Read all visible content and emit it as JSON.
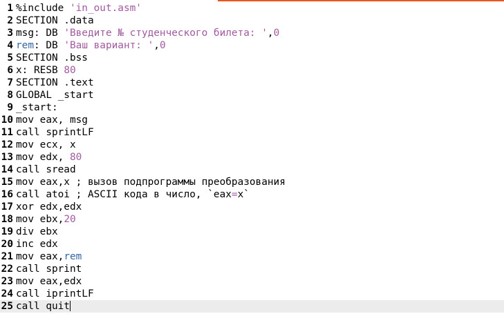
{
  "colors": {
    "accent": "#e95420",
    "string": "#a25aa0",
    "number": "#a25aa0",
    "identifier": "#3465a4",
    "current_line": "#ececec"
  },
  "editor": {
    "current_line": 25,
    "lines": [
      {
        "n": "1",
        "tokens": [
          {
            "t": "%include ",
            "c": "plain"
          },
          {
            "t": "'in_out.asm'",
            "c": "str"
          }
        ]
      },
      {
        "n": "2",
        "tokens": [
          {
            "t": "SECTION .data",
            "c": "plain"
          }
        ]
      },
      {
        "n": "3",
        "tokens": [
          {
            "t": "msg: DB ",
            "c": "plain"
          },
          {
            "t": "'Введите № студенческого билета: '",
            "c": "str"
          },
          {
            "t": ",",
            "c": "plain"
          },
          {
            "t": "0",
            "c": "num"
          }
        ]
      },
      {
        "n": "4",
        "tokens": [
          {
            "t": "rem",
            "c": "id"
          },
          {
            "t": ": DB ",
            "c": "plain"
          },
          {
            "t": "'Ваш вариант: '",
            "c": "str"
          },
          {
            "t": ",",
            "c": "plain"
          },
          {
            "t": "0",
            "c": "num"
          }
        ]
      },
      {
        "n": "5",
        "tokens": [
          {
            "t": "SECTION .bss",
            "c": "plain"
          }
        ]
      },
      {
        "n": "6",
        "tokens": [
          {
            "t": "x: RESB ",
            "c": "plain"
          },
          {
            "t": "80",
            "c": "num"
          }
        ]
      },
      {
        "n": "7",
        "tokens": [
          {
            "t": "SECTION .text",
            "c": "plain"
          }
        ]
      },
      {
        "n": "8",
        "tokens": [
          {
            "t": "GLOBAL _start",
            "c": "plain"
          }
        ]
      },
      {
        "n": "9",
        "tokens": [
          {
            "t": "_start:",
            "c": "plain"
          }
        ]
      },
      {
        "n": "10",
        "tokens": [
          {
            "t": "mov eax, msg",
            "c": "plain"
          }
        ]
      },
      {
        "n": "11",
        "tokens": [
          {
            "t": "call sprintLF",
            "c": "plain"
          }
        ]
      },
      {
        "n": "12",
        "tokens": [
          {
            "t": "mov ecx, x",
            "c": "plain"
          }
        ]
      },
      {
        "n": "13",
        "tokens": [
          {
            "t": "mov edx, ",
            "c": "plain"
          },
          {
            "t": "80",
            "c": "num"
          }
        ]
      },
      {
        "n": "14",
        "tokens": [
          {
            "t": "call sread",
            "c": "plain"
          }
        ]
      },
      {
        "n": "15",
        "tokens": [
          {
            "t": "mov eax,x ; вызов подпрограммы преобразования",
            "c": "plain"
          }
        ]
      },
      {
        "n": "16",
        "tokens": [
          {
            "t": "call atoi ; ASCII кода в число, `eax",
            "c": "plain"
          },
          {
            "t": "=",
            "c": "str"
          },
          {
            "t": "x`",
            "c": "plain"
          }
        ]
      },
      {
        "n": "17",
        "tokens": [
          {
            "t": "xor edx,edx",
            "c": "plain"
          }
        ]
      },
      {
        "n": "18",
        "tokens": [
          {
            "t": "mov ebx,",
            "c": "plain"
          },
          {
            "t": "20",
            "c": "num"
          }
        ]
      },
      {
        "n": "19",
        "tokens": [
          {
            "t": "div ebx",
            "c": "plain"
          }
        ]
      },
      {
        "n": "20",
        "tokens": [
          {
            "t": "inc edx",
            "c": "plain"
          }
        ]
      },
      {
        "n": "21",
        "tokens": [
          {
            "t": "mov eax,",
            "c": "plain"
          },
          {
            "t": "rem",
            "c": "id"
          }
        ]
      },
      {
        "n": "22",
        "tokens": [
          {
            "t": "call sprint",
            "c": "plain"
          }
        ]
      },
      {
        "n": "23",
        "tokens": [
          {
            "t": "mov eax,edx",
            "c": "plain"
          }
        ]
      },
      {
        "n": "24",
        "tokens": [
          {
            "t": "call iprintLF",
            "c": "plain"
          }
        ]
      },
      {
        "n": "25",
        "tokens": [
          {
            "t": "call quit",
            "c": "plain"
          }
        ]
      }
    ]
  }
}
